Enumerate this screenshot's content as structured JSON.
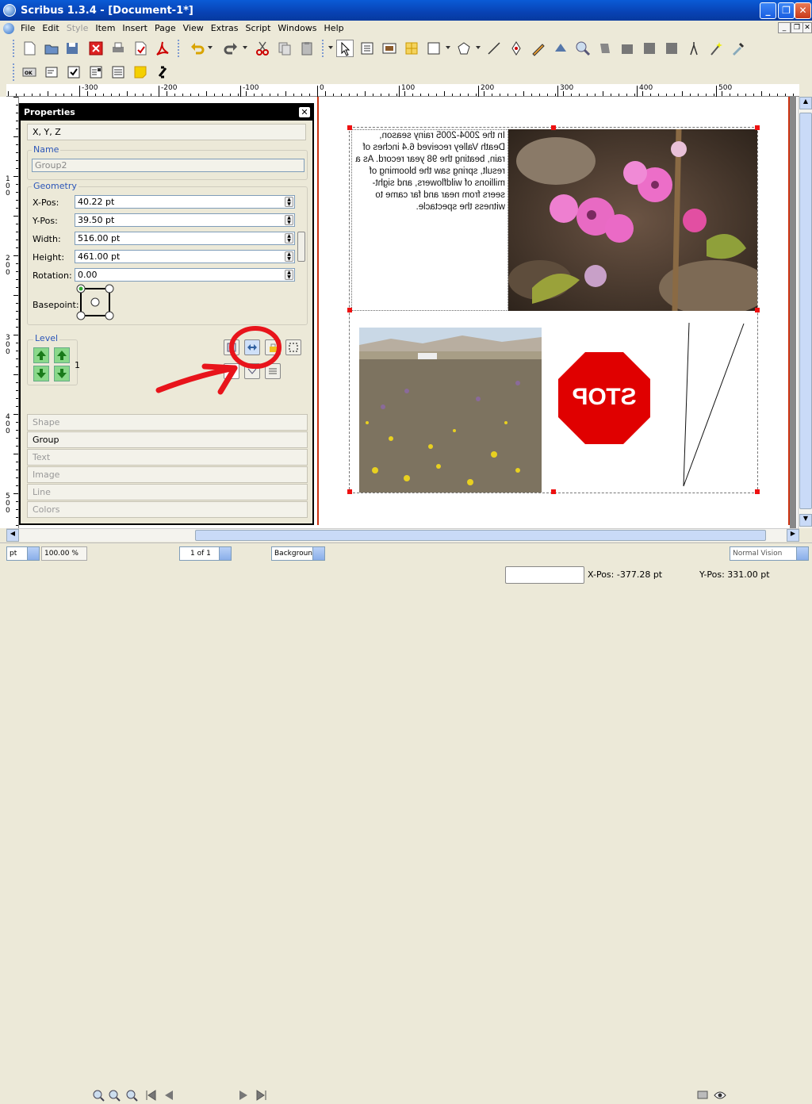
{
  "window": {
    "title": "Scribus 1.3.4 - [Document-1*]"
  },
  "menu": [
    "File",
    "Edit",
    "Style",
    "Item",
    "Insert",
    "Page",
    "View",
    "Extras",
    "Script",
    "Windows",
    "Help"
  ],
  "ruler": {
    "labels": [
      "-300",
      "-200",
      "-100",
      "0",
      "100",
      "200",
      "300",
      "400",
      "500"
    ],
    "vlabels": [
      "100",
      "200",
      "300",
      "400",
      "500"
    ]
  },
  "properties": {
    "title": "Properties",
    "close": "✕",
    "xyz_label": "X, Y, Z",
    "name_group": "Name",
    "name_value": "Group2",
    "geometry_group": "Geometry",
    "xpos_label": "X-Pos:",
    "xpos_value": "40.22 pt",
    "ypos_label": "Y-Pos:",
    "ypos_value": "39.50 pt",
    "width_label": "Width:",
    "width_value": "516.00 pt",
    "height_label": "Height:",
    "height_value": "461.00 pt",
    "rotation_label": "Rotation:",
    "rotation_value": "0.00",
    "basepoint_label": "Basepoint:",
    "level_group": "Level",
    "level_value": "1",
    "tabs": [
      "Shape",
      "Group",
      "Text",
      "Image",
      "Line",
      "Colors"
    ]
  },
  "page_text": "In the 2004-2005 rainy season, Death Valley received 6.4 inches of rain, beating the 98 year record. As a result, spring saw the blooming of millions of wildflowers, and sight-seers from near and far came to witness the spectacle.",
  "stop_sign": "STOP",
  "bottom": {
    "unit": "pt",
    "zoom": "100.00 %",
    "page": "1 of 1",
    "layer": "Background",
    "vision": "Normal Vision"
  },
  "status": {
    "xpos": "X-Pos: -377.28 pt",
    "ypos": "Y-Pos: 331.00 pt"
  },
  "colors": {
    "title_bar": "#0842b4",
    "annotation": "#e8141b",
    "stop": "#e00000"
  }
}
